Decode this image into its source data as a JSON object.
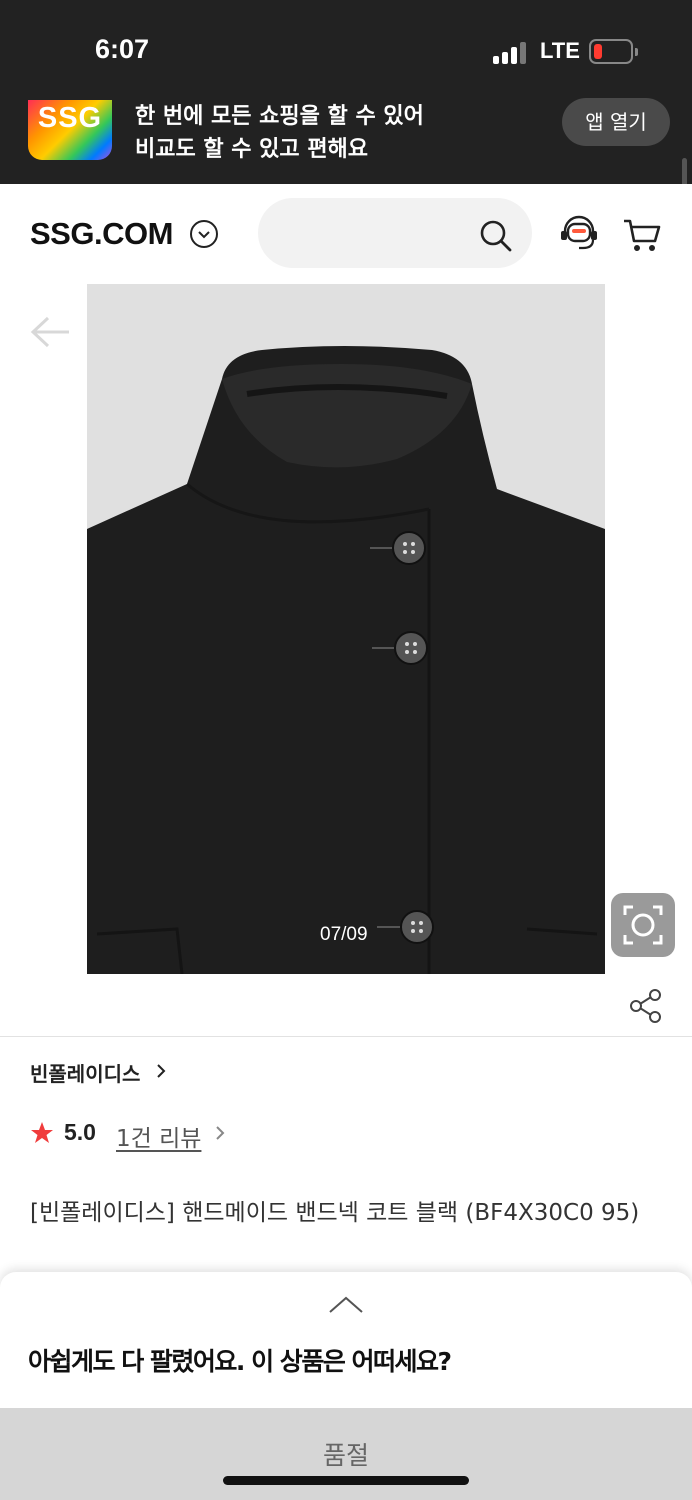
{
  "status_bar": {
    "time": "6:07",
    "network": "LTE",
    "battery_level": 0.12,
    "battery_color": "#ff3b30"
  },
  "app_banner": {
    "logo_text": "SSG",
    "line1": "한 번에 모든 쇼핑을 할 수 있어",
    "line2": "비교도 할 수 있고 편해요",
    "open_app_label": "앱 열기"
  },
  "header": {
    "logo": "SSG.COM",
    "logo_icon": "chevron-circle-down-icon",
    "search_placeholder": "",
    "search_icon": "search-icon",
    "support_icon": "customer-service-icon",
    "cart_icon": "cart-icon"
  },
  "gallery": {
    "counter": "07/09",
    "back_icon": "arrow-left-icon",
    "lens_icon": "image-search-icon",
    "share_icon": "share-icon"
  },
  "product": {
    "brand": "빈폴레이디스",
    "rating": "5.0",
    "review_link": "1건 리뷰",
    "title": "[빈폴레이디스] 핸드메이드 밴드넥 코트 블랙 (BF4X30C0 95)",
    "star_color": "#f03c3c"
  },
  "sheet": {
    "title": "아쉽게도 다 팔렸어요. 이 상품은 어떠세요?",
    "handle_icon": "chevron-up-icon",
    "soldout_label": "품절"
  }
}
